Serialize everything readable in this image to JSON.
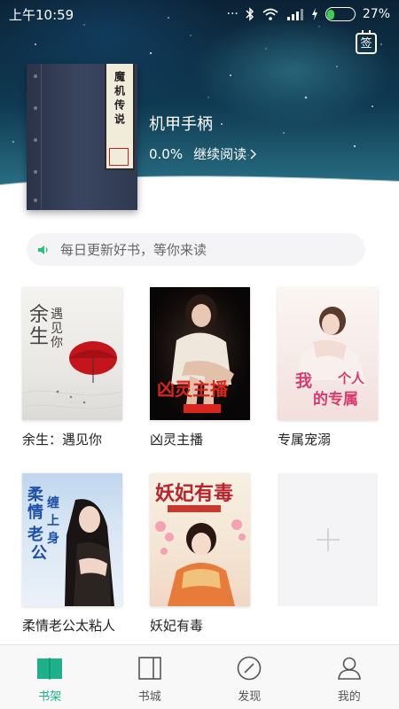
{
  "status_bar": {
    "time": "上午10:59",
    "battery": "27%",
    "battery_level": 0.27
  },
  "header": {
    "checkin_label": "签"
  },
  "current_book": {
    "cover_title": "魔机传说",
    "title": "机甲手柄",
    "progress": "0.0%",
    "continue_label": "继续阅读"
  },
  "notice": {
    "text": "每日更新好书，等你来读"
  },
  "shelf": {
    "books": [
      {
        "title": "余生：遇见你"
      },
      {
        "title": "凶灵主播"
      },
      {
        "title": "专属宠溺"
      },
      {
        "title": "柔情老公太粘人"
      },
      {
        "title": "妖妃有毒"
      }
    ]
  },
  "tabs": [
    {
      "label": "书架",
      "icon": "bookshelf-icon",
      "active": true
    },
    {
      "label": "书城",
      "icon": "bookstore-icon",
      "active": false
    },
    {
      "label": "发现",
      "icon": "discover-icon",
      "active": false
    },
    {
      "label": "我的",
      "icon": "profile-icon",
      "active": false
    }
  ],
  "colors": {
    "accent": "#1db08b",
    "notice_icon": "#27c07a"
  }
}
